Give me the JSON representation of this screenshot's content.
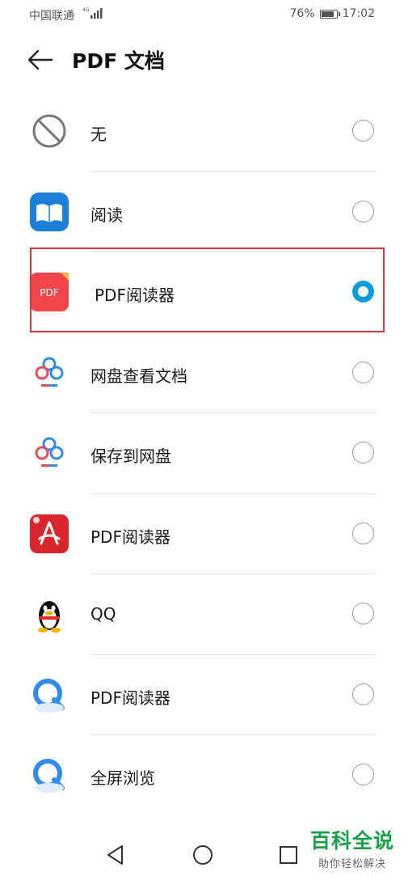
{
  "status_bar": {
    "carrier": "中国联通",
    "network": "4G",
    "battery": "76%",
    "time": "17:02"
  },
  "header": {
    "title": "PDF 文档",
    "back_icon": "arrow-left-icon"
  },
  "options": [
    {
      "label": "无",
      "icon": "none-circle-icon",
      "selected": false
    },
    {
      "label": "阅读",
      "icon": "book-reader-icon",
      "selected": false
    },
    {
      "label": "PDF阅读器",
      "icon": "pdf-red-icon",
      "icon_text": "PDF",
      "selected": true
    },
    {
      "label": "网盘查看文档",
      "icon": "baidu-cloud-icon",
      "selected": false
    },
    {
      "label": "保存到网盘",
      "icon": "baidu-cloud-icon",
      "selected": false
    },
    {
      "label": "PDF阅读器",
      "icon": "acrobat-icon",
      "selected": false
    },
    {
      "label": "QQ",
      "icon": "qq-penguin-icon",
      "selected": false
    },
    {
      "label": "PDF阅读器",
      "icon": "qq-browser-icon",
      "selected": false
    },
    {
      "label": "全屏浏览",
      "icon": "qq-browser-icon",
      "selected": false
    }
  ],
  "nav": {
    "back": "triangle-back-icon",
    "home": "circle-home-icon",
    "recents": "square-recents-icon"
  },
  "watermark": {
    "title": "百科全说",
    "subtitle": "助你轻松解决"
  },
  "colors": {
    "accent": "#0a9dd9",
    "highlight": "#d9363e",
    "watermark": "#17a24a"
  }
}
